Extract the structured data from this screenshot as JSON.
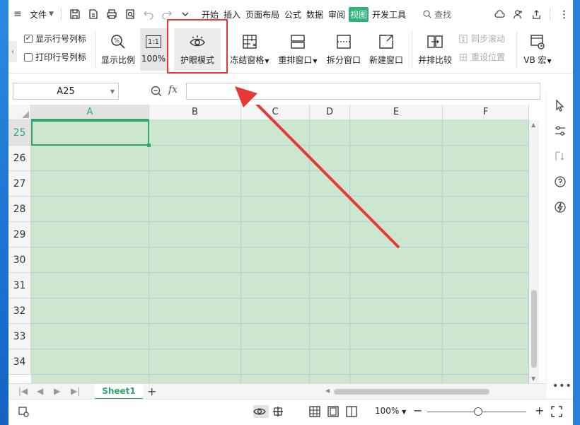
{
  "menubar": {
    "file_label": "文件",
    "tabs": [
      {
        "label": "开始",
        "active": false
      },
      {
        "label": "插入",
        "active": false
      },
      {
        "label": "页面布局",
        "active": false
      },
      {
        "label": "公式",
        "active": false
      },
      {
        "label": "数据",
        "active": false
      },
      {
        "label": "审阅",
        "active": false
      },
      {
        "label": "视图",
        "active": true
      },
      {
        "label": "开发工具",
        "active": false
      }
    ],
    "search_label": "查找"
  },
  "ribbon": {
    "show_rowcol_label": "显示行号列标",
    "show_rowcol_checked": true,
    "print_rowcol_label": "打印行号列标",
    "print_rowcol_checked": false,
    "zoom_ratio_label": "显示比例",
    "zoom_100_label": "100%",
    "zoom_box_text": "1:1",
    "eye_mode_label": "护眼模式",
    "freeze_label": "冻结窗格",
    "rearrange_label": "重排窗口",
    "split_label": "拆分窗口",
    "new_window_label": "新建窗口",
    "side_by_side_label": "并排比较",
    "sync_scroll_label": "同步滚动",
    "reset_position_label": "重设位置",
    "vb_macro_label": "VB 宏"
  },
  "formula_bar": {
    "name_box": "A25",
    "fx_label": "fx",
    "formula_value": ""
  },
  "grid": {
    "columns": [
      "A",
      "B",
      "C",
      "D",
      "E",
      "F"
    ],
    "rows": [
      "25",
      "26",
      "27",
      "28",
      "29",
      "30",
      "31",
      "32",
      "33",
      "34"
    ],
    "selected_col": "A",
    "selected_row": "25"
  },
  "sheets": {
    "tabs": [
      "Sheet1"
    ],
    "active": "Sheet1"
  },
  "status": {
    "zoom_text": "100%"
  },
  "colors": {
    "accent": "#2fb27b",
    "eye_bg": "#cde6cf",
    "highlight": "#e53935"
  }
}
